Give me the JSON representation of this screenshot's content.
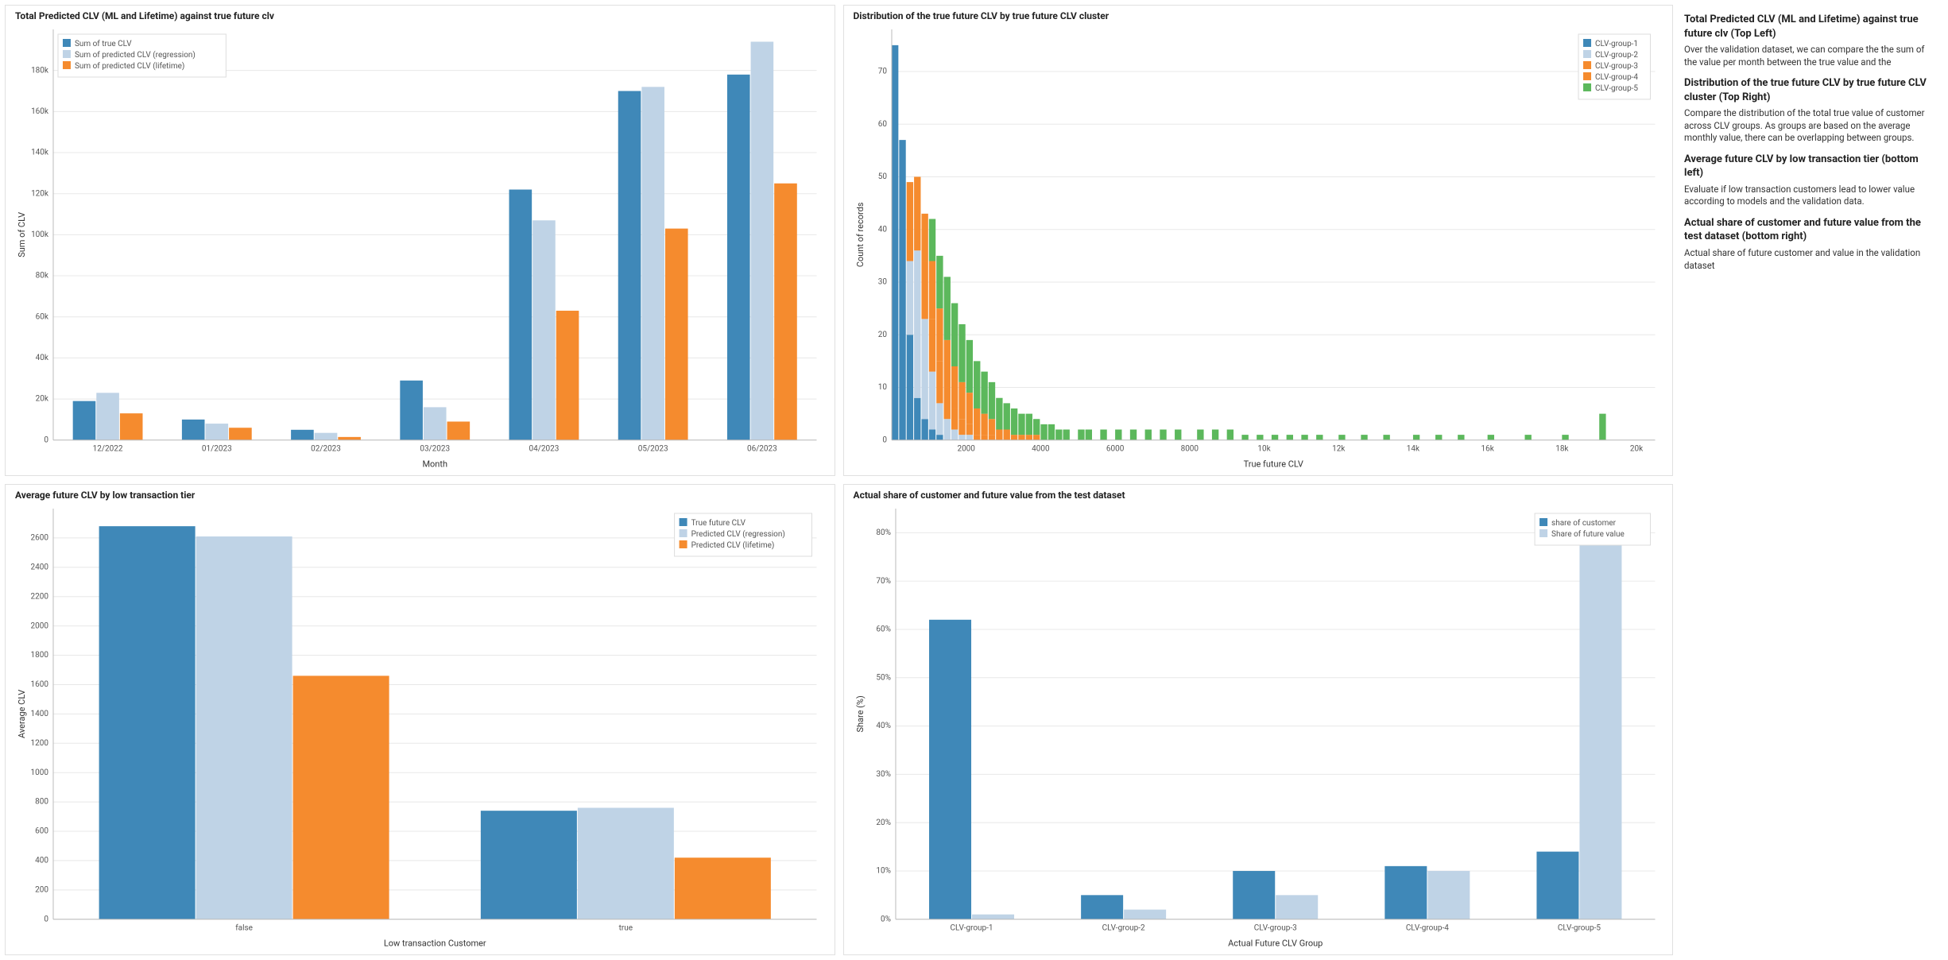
{
  "colors": {
    "blue": "#3f88b8",
    "lightblue": "#bfd3e6",
    "orange": "#f58b2e",
    "green": "#5cb85c",
    "border": "#e0e0e0",
    "grid": "#e8e8e8"
  },
  "chart_data": [
    {
      "id": "chart-tl",
      "type": "bar",
      "title": "Total Predicted CLV (ML and Lifetime) against true future clv",
      "xlabel": "Month",
      "ylabel": "Sum of CLV",
      "categories": [
        "12/2022",
        "01/2023",
        "02/2023",
        "03/2023",
        "04/2023",
        "05/2023",
        "06/2023"
      ],
      "series": [
        {
          "name": "Sum of true CLV",
          "color": "blue",
          "values": [
            19000,
            10000,
            5000,
            29000,
            122000,
            170000,
            178000
          ]
        },
        {
          "name": "Sum of predicted CLV (regression)",
          "color": "lightblue",
          "values": [
            23000,
            8000,
            3500,
            16000,
            107000,
            172000,
            194000
          ]
        },
        {
          "name": "Sum of predicted CLV (lifetime)",
          "color": "orange",
          "values": [
            13000,
            6000,
            1500,
            9000,
            63000,
            103000,
            125000
          ]
        }
      ],
      "ylim": [
        0,
        200000
      ],
      "yticks": [
        0,
        20000,
        40000,
        60000,
        80000,
        100000,
        120000,
        140000,
        160000,
        180000
      ],
      "ytick_labels": [
        "0",
        "20k",
        "40k",
        "60k",
        "80k",
        "100k",
        "120k",
        "140k",
        "160k",
        "180k"
      ],
      "legend_pos": "top-left"
    },
    {
      "id": "chart-tr",
      "type": "histogram_stacked",
      "title": "Distribution of the true future CLV by true future CLV cluster",
      "xlabel": "True future CLV",
      "ylabel": "Count of records",
      "xlim": [
        0,
        20500
      ],
      "xticks": [
        2000,
        4000,
        6000,
        8000,
        10000,
        12000,
        14000,
        16000,
        18000,
        20000
      ],
      "xtick_labels": [
        "2000",
        "4000",
        "6000",
        "8000",
        "10k",
        "12k",
        "14k",
        "16k",
        "18k",
        "20k"
      ],
      "ylim": [
        0,
        78
      ],
      "yticks": [
        0,
        10,
        20,
        30,
        40,
        50,
        60,
        70
      ],
      "bin_width": 200,
      "bins_x": [
        0,
        200,
        400,
        600,
        800,
        1000,
        1200,
        1400,
        1600,
        1800,
        2000,
        2200,
        2400,
        2600,
        2800,
        3000,
        3200,
        3400,
        3600,
        3800,
        4000,
        4200,
        4400,
        4600,
        5000,
        5200,
        5600,
        6000,
        6400,
        6800,
        7200,
        7600,
        8200,
        8600,
        9000,
        9400,
        9800,
        10200,
        10600,
        11000,
        11400,
        12000,
        12600,
        13200,
        14000,
        14600,
        15200,
        16000,
        17000,
        18000,
        19000,
        20200
      ],
      "series": [
        {
          "name": "CLV-group-1",
          "color": "blue",
          "values": [
            75,
            57,
            20,
            8,
            4,
            2,
            1,
            0,
            0,
            0,
            0,
            0,
            0,
            0,
            0,
            0,
            0,
            0,
            0,
            0,
            0,
            0,
            0,
            0,
            0,
            0,
            0,
            0,
            0,
            0,
            0,
            0,
            0,
            0,
            0,
            0,
            0,
            0,
            0,
            0,
            0,
            0,
            0,
            0,
            0,
            0,
            0,
            0,
            0,
            0,
            0
          ]
        },
        {
          "name": "CLV-group-2",
          "color": "lightblue",
          "values": [
            0,
            0,
            14,
            28,
            19,
            11,
            6,
            4,
            2,
            1,
            1,
            0,
            0,
            0,
            0,
            0,
            0,
            0,
            0,
            0,
            0,
            0,
            0,
            0,
            0,
            0,
            0,
            0,
            0,
            0,
            0,
            0,
            0,
            0,
            0,
            0,
            0,
            0,
            0,
            0,
            0,
            0,
            0,
            0,
            0,
            0,
            0,
            0,
            0,
            0,
            0
          ]
        },
        {
          "name": "CLV-group-3",
          "color": "orange",
          "values": [
            0,
            0,
            15,
            14,
            11,
            10,
            8,
            6,
            4,
            3,
            2,
            1,
            1,
            1,
            0,
            0,
            0,
            0,
            0,
            0,
            0,
            0,
            0,
            0,
            0,
            0,
            0,
            0,
            0,
            0,
            0,
            0,
            0,
            0,
            0,
            0,
            0,
            0,
            0,
            0,
            0,
            0,
            0,
            0,
            0,
            0,
            0,
            0,
            0,
            0,
            0
          ]
        },
        {
          "name": "CLV-group-4",
          "color": "orange",
          "values": [
            0,
            0,
            0,
            0,
            9,
            11,
            10,
            9,
            8,
            7,
            6,
            5,
            4,
            3,
            2,
            2,
            1,
            1,
            1,
            1,
            0,
            0,
            0,
            0,
            0,
            0,
            0,
            0,
            0,
            0,
            0,
            0,
            0,
            0,
            0,
            0,
            0,
            0,
            0,
            0,
            0,
            0,
            0,
            0,
            0,
            0,
            0,
            0,
            0,
            0,
            0
          ]
        },
        {
          "name": "CLV-group-5",
          "color": "green",
          "values": [
            0,
            0,
            0,
            0,
            0,
            8,
            10,
            12,
            12,
            11,
            10,
            9,
            8,
            7,
            6,
            5,
            5,
            4,
            4,
            3,
            3,
            3,
            2,
            2,
            2,
            2,
            2,
            2,
            2,
            2,
            2,
            2,
            2,
            2,
            2,
            1,
            1,
            1,
            1,
            1,
            1,
            1,
            1,
            1,
            1,
            1,
            1,
            1,
            1,
            1,
            5
          ]
        }
      ],
      "legend_pos": "top-right"
    },
    {
      "id": "chart-bl",
      "type": "bar",
      "title": "Average future CLV by low transaction tier",
      "xlabel": "Low transaction Customer",
      "ylabel": "Average CLV",
      "categories": [
        "false",
        "true"
      ],
      "series": [
        {
          "name": "True future CLV",
          "color": "blue",
          "values": [
            2680,
            740
          ]
        },
        {
          "name": "Predicted CLV (regression)",
          "color": "lightblue",
          "values": [
            2610,
            760
          ]
        },
        {
          "name": "Predicted CLV (lifetime)",
          "color": "orange",
          "values": [
            1660,
            420
          ]
        }
      ],
      "ylim": [
        0,
        2800
      ],
      "yticks": [
        0,
        200,
        400,
        600,
        800,
        1000,
        1200,
        1400,
        1600,
        1800,
        2000,
        2200,
        2400,
        2600
      ],
      "legend_pos": "top-right"
    },
    {
      "id": "chart-br",
      "type": "bar",
      "title": "Actual share of customer and future value from the test dataset",
      "xlabel": "Actual Future CLV Group",
      "ylabel": "Share (%)",
      "categories": [
        "CLV-group-1",
        "CLV-group-2",
        "CLV-group-3",
        "CLV-group-4",
        "CLV-group-5"
      ],
      "series": [
        {
          "name": "share of customer",
          "color": "blue",
          "values": [
            62,
            5,
            10,
            11,
            14
          ]
        },
        {
          "name": "Share of future value",
          "color": "lightblue",
          "values": [
            1,
            2,
            5,
            10,
            82
          ]
        }
      ],
      "ylim": [
        0,
        85
      ],
      "yticks": [
        0,
        10,
        20,
        30,
        40,
        50,
        60,
        70,
        80
      ],
      "ytick_labels": [
        "0%",
        "10%",
        "20%",
        "30%",
        "40%",
        "50%",
        "60%",
        "70%",
        "80%"
      ],
      "legend_pos": "top-right"
    }
  ],
  "sidebar": {
    "sections": [
      {
        "heading": "Total Predicted CLV (ML and Lifetime) against true future clv (Top Left)",
        "body": "Over the validation dataset, we can compare the the sum of the value per month between the true value and the"
      },
      {
        "heading": "Distribution of the true future CLV by true future CLV cluster (Top Right)",
        "body": "Compare the distribution of the total true value of customer across CLV groups. As groups are based on the average monthly value, there can be overlapping between groups."
      },
      {
        "heading": "Average future CLV by low transaction tier (bottom left)",
        "body": "Evaluate if low transaction customers lead to lower value according to models and the validation data."
      },
      {
        "heading": "Actual share of customer and future value from the test dataset (bottom right)",
        "body": "Actual share of future customer and value in the validation dataset"
      }
    ]
  }
}
